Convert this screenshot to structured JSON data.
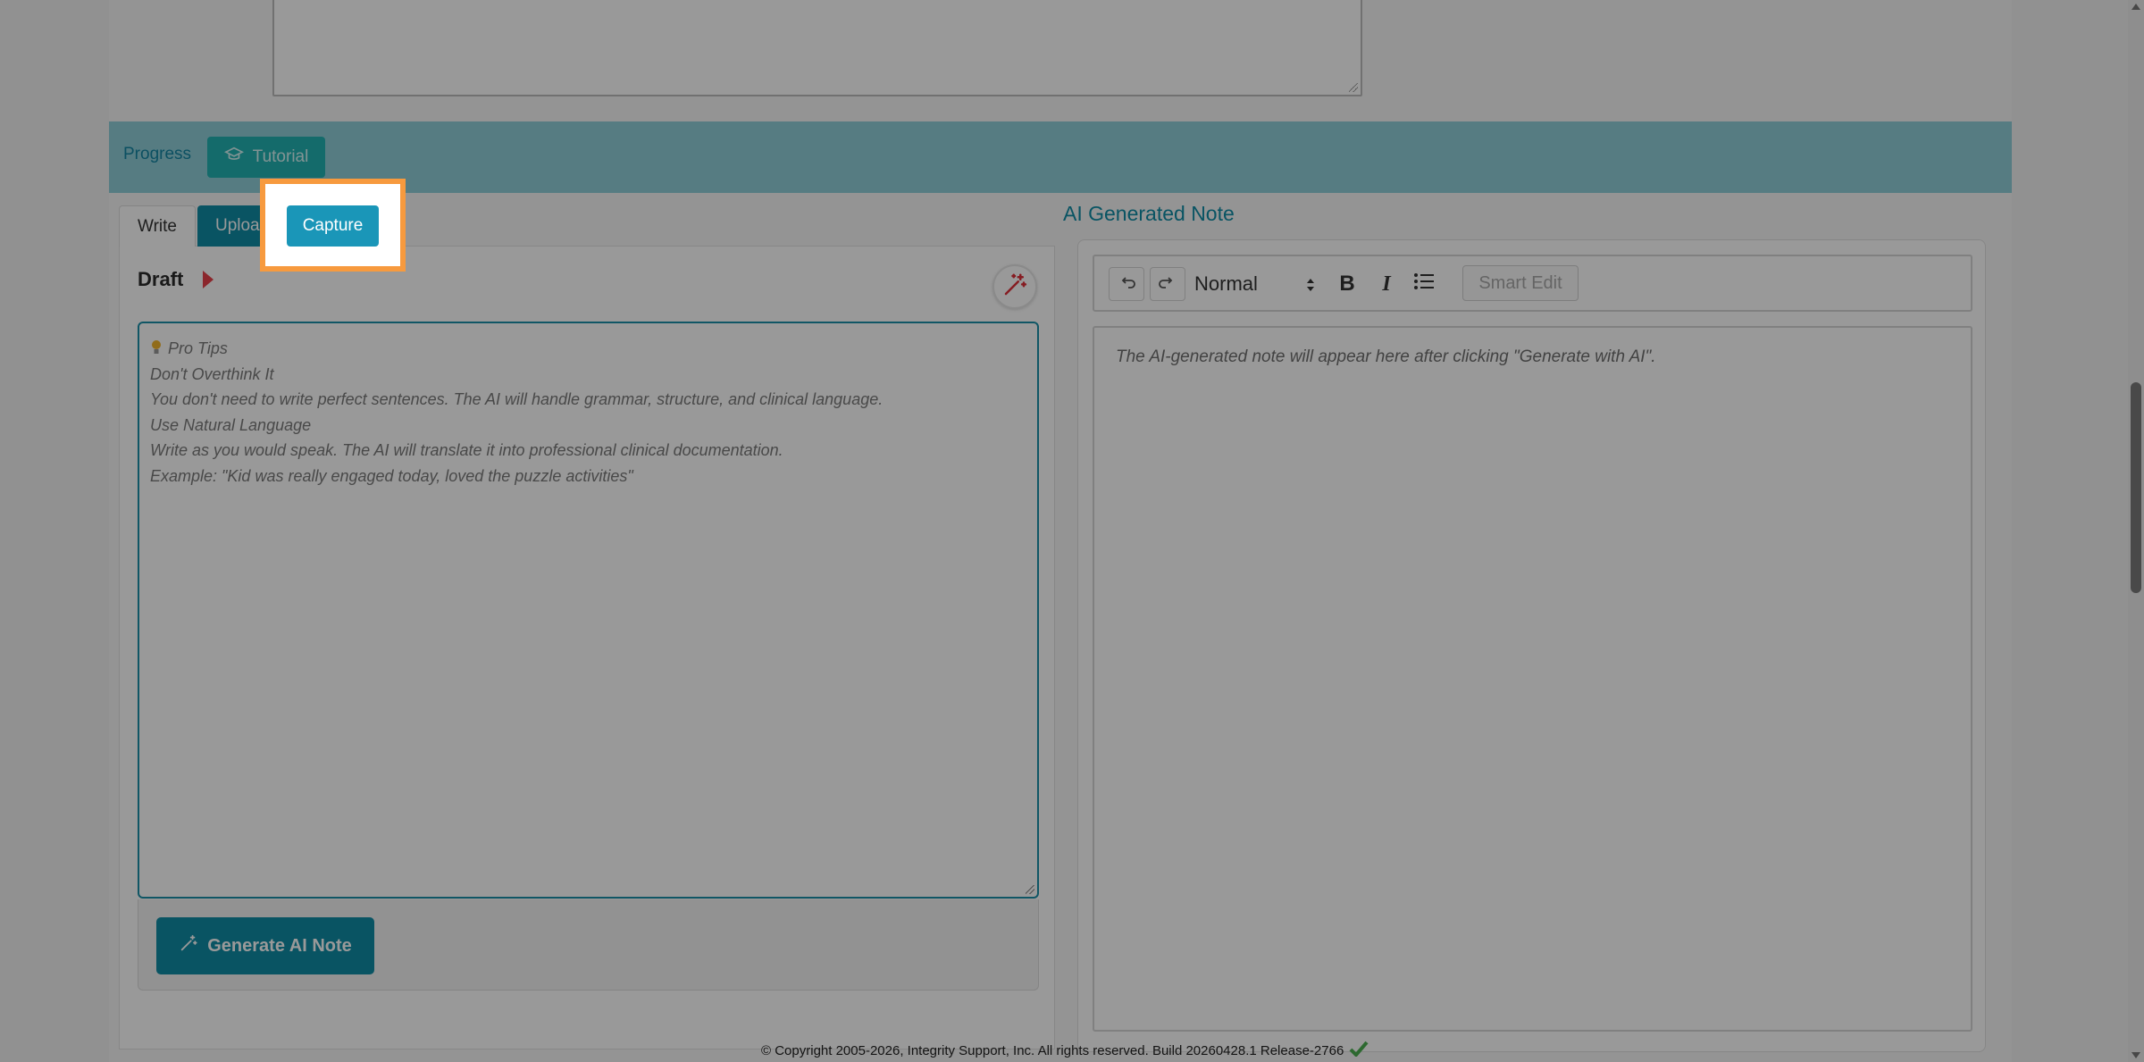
{
  "progress": {
    "label": "Progress",
    "tutorial_label": "Tutorial"
  },
  "tabs": {
    "write": "Write",
    "upload": "Upload",
    "capture": "Capture"
  },
  "draft": {
    "title": "Draft",
    "tips": [
      "Pro Tips",
      "Don't Overthink It",
      "You don't need to write perfect sentences. The AI will handle grammar, structure, and clinical language.",
      "Use Natural Language",
      "Write as you would speak. The AI will translate it into professional clinical documentation.",
      "Example: \"Kid was really engaged today, loved the puzzle activities\""
    ],
    "generate_label": "Generate AI Note"
  },
  "ai_note": {
    "title": "AI Generated Note",
    "format": "Normal",
    "bold": "B",
    "italic": "I",
    "smart_edit": "Smart Edit",
    "placeholder": "The AI-generated note will appear here after clicking \"Generate with AI\"."
  },
  "footer": {
    "copyright": "© Copyright 2005-2026, Integrity Support, Inc. All rights reserved. Build 20260428.1 Release-2766"
  },
  "colors": {
    "accent": "#0f8ca6",
    "highlight": "#f79a3e",
    "teal": "#22b3b3",
    "arrow": "#e8404a",
    "check": "#4caf50"
  },
  "icons": [
    "graduation-cap-icon",
    "magic-wand-icon",
    "undo-icon",
    "redo-icon",
    "list-icon",
    "lightbulb-icon",
    "checkmark-icon"
  ]
}
